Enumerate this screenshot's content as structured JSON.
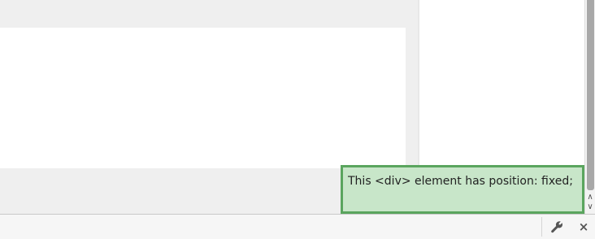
{
  "fixed_element": {
    "text": "This <div> element has position: fixed;",
    "background_color": "#c8e6c9",
    "border_color": "#5aa55e"
  },
  "scrollbar": {
    "up_arrow": "∧",
    "down_arrow": "∨"
  },
  "toolbar": {
    "close_label": "×",
    "icons": [
      "wrench-icon",
      "close-icon"
    ]
  }
}
